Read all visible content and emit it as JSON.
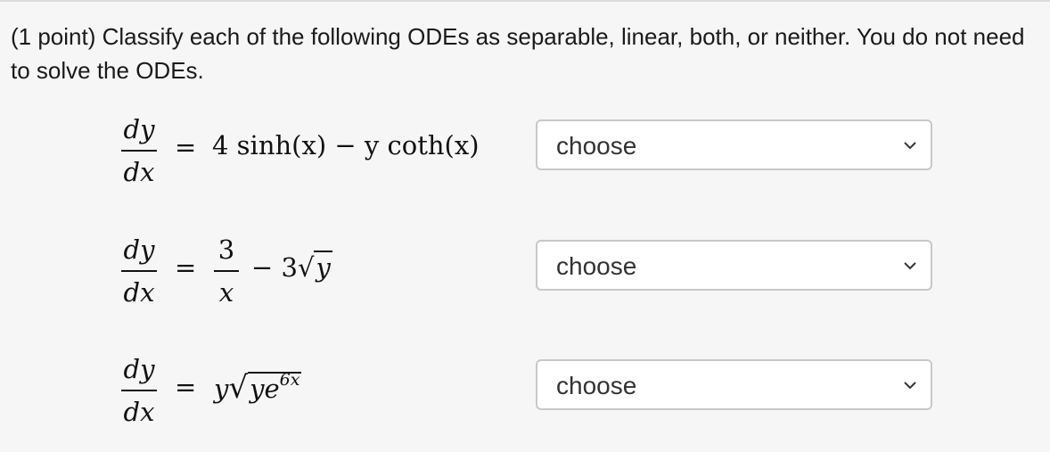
{
  "question": {
    "prompt": "(1 point) Classify each of the following ODEs as separable, linear, both, or neither. You do not need to solve the ODEs."
  },
  "equations": [
    {
      "lhs_num": "dy",
      "lhs_den": "dx",
      "eq": "=",
      "rhs_text": "4 sinh(x) − y coth(x)",
      "select": {
        "value": "choose"
      }
    },
    {
      "lhs_num": "dy",
      "lhs_den": "dx",
      "eq": "=",
      "rhs_frac_num": "3",
      "rhs_frac_den": "x",
      "rhs_minus": "−",
      "rhs_coef": "3",
      "rhs_sqrt": "y",
      "select": {
        "value": "choose"
      }
    },
    {
      "lhs_num": "dy",
      "lhs_den": "dx",
      "eq": "=",
      "rhs_prefix": "y",
      "rhs_sqrt": "ye",
      "rhs_sup": "6x",
      "select": {
        "value": "choose"
      }
    }
  ],
  "icons": {
    "dropdown": "chevron-down-icon"
  }
}
